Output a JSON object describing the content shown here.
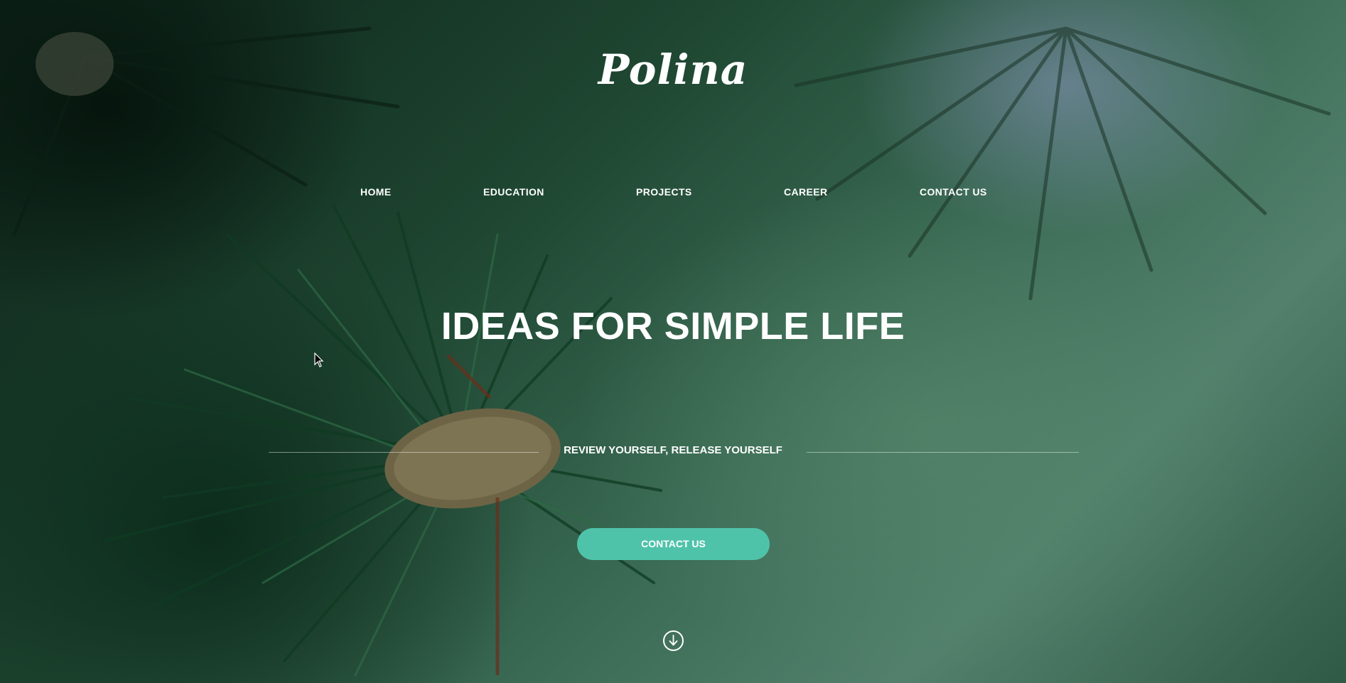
{
  "site": {
    "logo_text": "Polina"
  },
  "nav": {
    "items": [
      {
        "label": "HOME"
      },
      {
        "label": "EDUCATION"
      },
      {
        "label": "PROJECTS"
      },
      {
        "label": "CAREER"
      },
      {
        "label": "CONTACT US"
      }
    ]
  },
  "hero": {
    "headline": "IDEAS FOR SIMPLE LIFE",
    "tagline": "REVIEW YOURSELF, RELEASE YOURSELF",
    "cta_label": "CONTACT US",
    "scroll_icon": "arrow-down-circle-icon",
    "accent_color": "#4fc3aa"
  }
}
